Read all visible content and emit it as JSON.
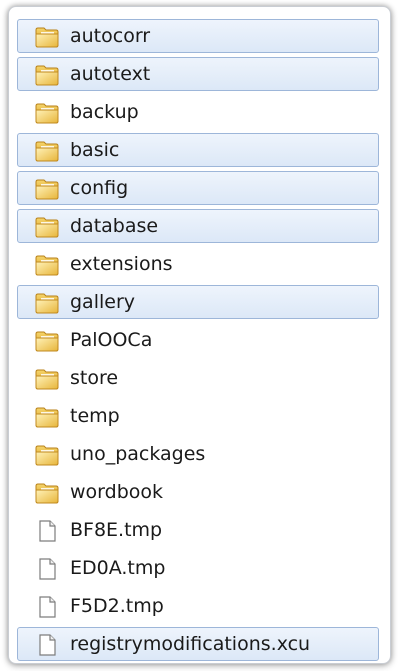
{
  "explorer": {
    "items": [
      {
        "name": "autocorr",
        "type": "folder",
        "selected": true
      },
      {
        "name": "autotext",
        "type": "folder",
        "selected": true
      },
      {
        "name": "backup",
        "type": "folder",
        "selected": false
      },
      {
        "name": "basic",
        "type": "folder",
        "selected": true
      },
      {
        "name": "config",
        "type": "folder",
        "selected": true
      },
      {
        "name": "database",
        "type": "folder",
        "selected": true
      },
      {
        "name": "extensions",
        "type": "folder",
        "selected": false
      },
      {
        "name": "gallery",
        "type": "folder",
        "selected": true
      },
      {
        "name": "PalOOCa",
        "type": "folder",
        "selected": false
      },
      {
        "name": "store",
        "type": "folder",
        "selected": false
      },
      {
        "name": "temp",
        "type": "folder",
        "selected": false
      },
      {
        "name": "uno_packages",
        "type": "folder",
        "selected": false
      },
      {
        "name": "wordbook",
        "type": "folder",
        "selected": false
      },
      {
        "name": "BF8E.tmp",
        "type": "file",
        "selected": false
      },
      {
        "name": "ED0A.tmp",
        "type": "file",
        "selected": false
      },
      {
        "name": "F5D2.tmp",
        "type": "file",
        "selected": false
      },
      {
        "name": "registrymodifications.xcu",
        "type": "file",
        "selected": true
      }
    ]
  },
  "icons": {
    "folder": "folder-icon",
    "file": "file-icon"
  },
  "colors": {
    "selection_fill": "#dce8f7",
    "selection_border": "#9db6d9",
    "folder_yellow": "#f2c94c",
    "folder_dark": "#d99e1f"
  }
}
